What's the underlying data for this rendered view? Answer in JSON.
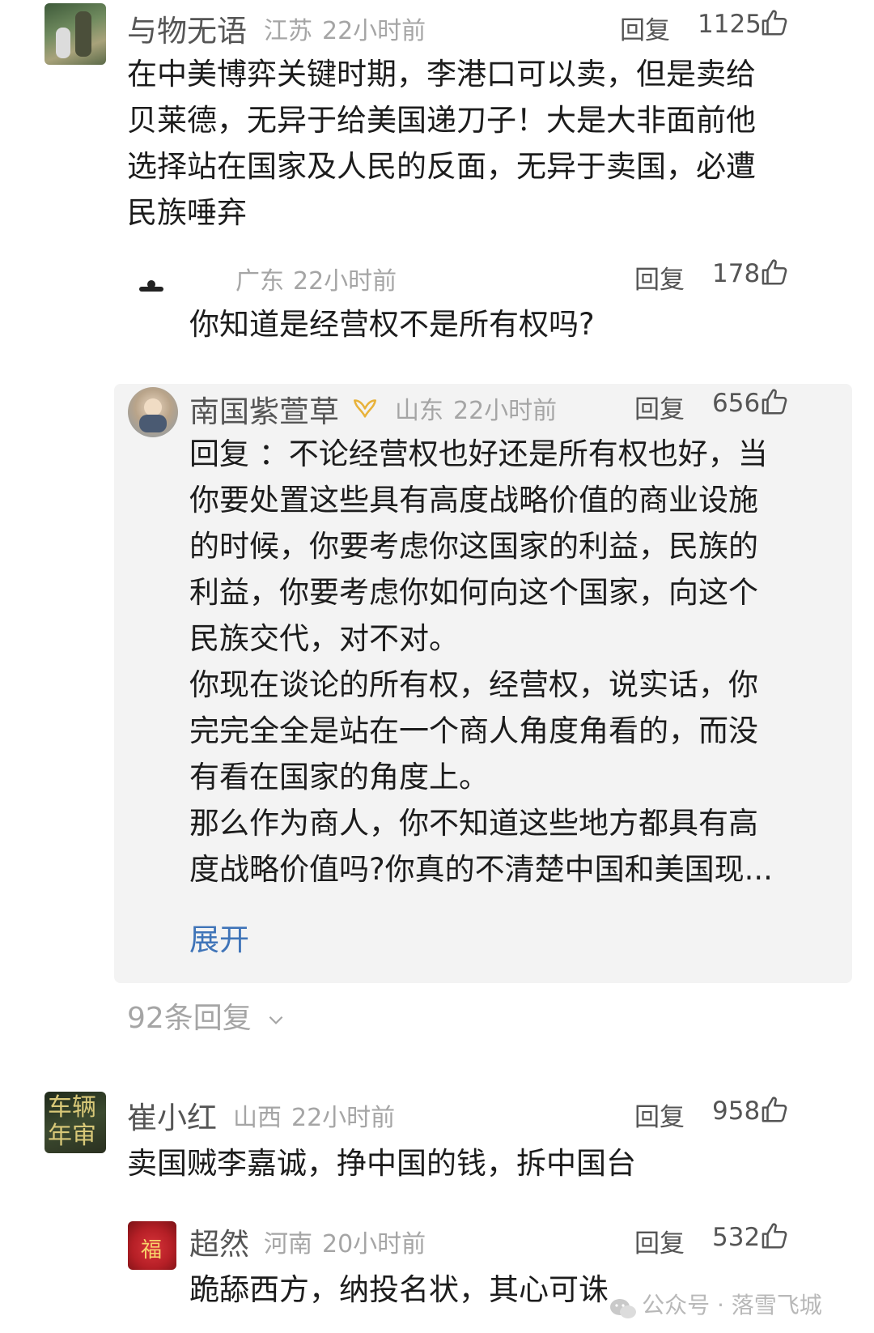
{
  "comments": [
    {
      "username": "与物无语",
      "location": "江苏",
      "time": "22小时前",
      "reply_label": "回复",
      "likes": "1125",
      "lines": [
        "在中美博弈关键时期，李港口可以卖，但是卖给",
        "贝莱德，无异于给美国递刀子！大是大非面前他",
        "选择站在国家及人民的反面，无异于卖国，必遭",
        "民族唾弃"
      ],
      "replies": [
        {
          "username": "",
          "location": "广东",
          "time": "22小时前",
          "reply_label": "回复",
          "likes": "178",
          "text": "你知道是经营权不是所有权吗?"
        },
        {
          "username": "南国紫萱草",
          "location": "山东",
          "time": "22小时前",
          "reply_label": "回复",
          "likes": "656",
          "lines": [
            "回复 ：不论经营权也好还是所有权也好，当",
            "你要处置这些具有高度战略价值的商业设施",
            "的时候，你要考虑你这国家的利益，民族的",
            "利益，你要考虑你如何向这个国家，向这个",
            "民族交代，对不对。",
            "你现在谈论的所有权，经营权，说实话，你",
            "完完全全是站在一个商人角度角看的，而没",
            "有看在国家的角度上。",
            "那么作为商人，你不知道这些地方都具有高",
            "度战略价值吗?你真的不清楚中国和美国现..."
          ],
          "expand_label": "展开"
        }
      ],
      "more_replies": "92条回复"
    },
    {
      "username": "崔小红",
      "location": "山西",
      "time": "22小时前",
      "reply_label": "回复",
      "likes": "958",
      "text": "卖国贼李嘉诚，挣中国的钱，拆中国台",
      "avatar_text": "车辆年审",
      "replies": [
        {
          "username": "超然",
          "location": "河南",
          "time": "20小时前",
          "reply_label": "回复",
          "likes": "532",
          "text": "跪舔西方，纳投名状，其心可诛",
          "avatar_text": "福"
        }
      ]
    }
  ],
  "watermark": "公众号 · 落雪飞城",
  "colors": {
    "link": "#3f74b8",
    "meta": "#a5a5a5",
    "reply_bg": "#f3f3f3",
    "badge": "#e8b23a"
  },
  "icons": [
    "thumbs-up-icon",
    "chevron-down-icon",
    "vip-badge-icon",
    "wechat-icon"
  ]
}
